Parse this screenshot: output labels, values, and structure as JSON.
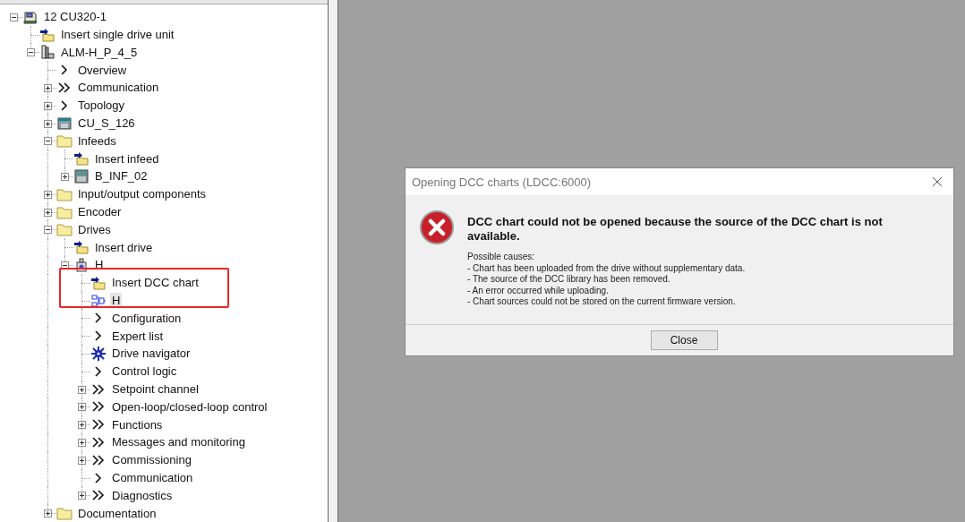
{
  "tree": [
    {
      "label": "12 CU320-1",
      "kind": "computer",
      "expanded": true,
      "selected": false,
      "children": [
        {
          "label": "Insert single drive unit",
          "kind": "insert",
          "selected": false
        },
        {
          "label": "ALM-H_P_4_5",
          "kind": "drive-unit",
          "expanded": true,
          "selected": false,
          "children": [
            {
              "label": "Overview",
              "kind": "chevron",
              "selected": false
            },
            {
              "label": "Communication",
              "kind": "double-chevron",
              "expanded": false,
              "selected": false
            },
            {
              "label": "Topology",
              "kind": "chevron",
              "expanded": false,
              "selected": false
            },
            {
              "label": "CU_S_126",
              "kind": "cu",
              "expanded": false,
              "selected": false
            },
            {
              "label": "Infeeds",
              "kind": "folder",
              "expanded": true,
              "selected": false,
              "children": [
                {
                  "label": "Insert infeed",
                  "kind": "insert",
                  "selected": false
                },
                {
                  "label": "B_INF_02",
                  "kind": "module",
                  "expanded": false,
                  "selected": false
                }
              ]
            },
            {
              "label": "Input/output components",
              "kind": "folder",
              "expanded": false,
              "selected": false
            },
            {
              "label": "Encoder",
              "kind": "folder",
              "expanded": false,
              "selected": false
            },
            {
              "label": "Drives",
              "kind": "folder",
              "expanded": true,
              "selected": false,
              "children": [
                {
                  "label": "Insert drive",
                  "kind": "insert",
                  "selected": false
                },
                {
                  "label": "H",
                  "kind": "drive",
                  "expanded": true,
                  "selected": false,
                  "children": [
                    {
                      "label": "Insert DCC chart",
                      "kind": "insert",
                      "selected": false,
                      "marked": true
                    },
                    {
                      "label": "H",
                      "kind": "dcc",
                      "selected": true,
                      "marked": true
                    },
                    {
                      "label": "Configuration",
                      "kind": "chevron",
                      "selected": false
                    },
                    {
                      "label": "Expert list",
                      "kind": "chevron",
                      "selected": false
                    },
                    {
                      "label": "Drive navigator",
                      "kind": "navigator",
                      "selected": false
                    },
                    {
                      "label": "Control logic",
                      "kind": "chevron",
                      "selected": false
                    },
                    {
                      "label": "Setpoint channel",
                      "kind": "double-chevron",
                      "expanded": false,
                      "selected": false
                    },
                    {
                      "label": "Open-loop/closed-loop control",
                      "kind": "double-chevron",
                      "expanded": false,
                      "selected": false
                    },
                    {
                      "label": "Functions",
                      "kind": "double-chevron",
                      "expanded": false,
                      "selected": false
                    },
                    {
                      "label": "Messages and monitoring",
                      "kind": "double-chevron",
                      "expanded": false,
                      "selected": false
                    },
                    {
                      "label": "Commissioning",
                      "kind": "double-chevron",
                      "expanded": false,
                      "selected": false
                    },
                    {
                      "label": "Communication",
                      "kind": "chevron",
                      "selected": false
                    },
                    {
                      "label": "Diagnostics",
                      "kind": "double-chevron",
                      "expanded": false,
                      "selected": false
                    }
                  ]
                }
              ]
            },
            {
              "label": "Documentation",
              "kind": "folder",
              "expanded": false,
              "selected": false
            }
          ]
        }
      ]
    }
  ],
  "dialog": {
    "title": "Opening DCC charts (LDCC:6000)",
    "message": "DCC chart could not be opened because the source of the DCC chart is not available.",
    "details": [
      "Possible causes:",
      "- Chart has been uploaded from the drive without supplementary data.",
      "- The source of the DCC library has been removed.",
      "- An error occurred while uploading.",
      "- Chart sources could not be stored on the current firmware version."
    ],
    "button": "Close"
  }
}
